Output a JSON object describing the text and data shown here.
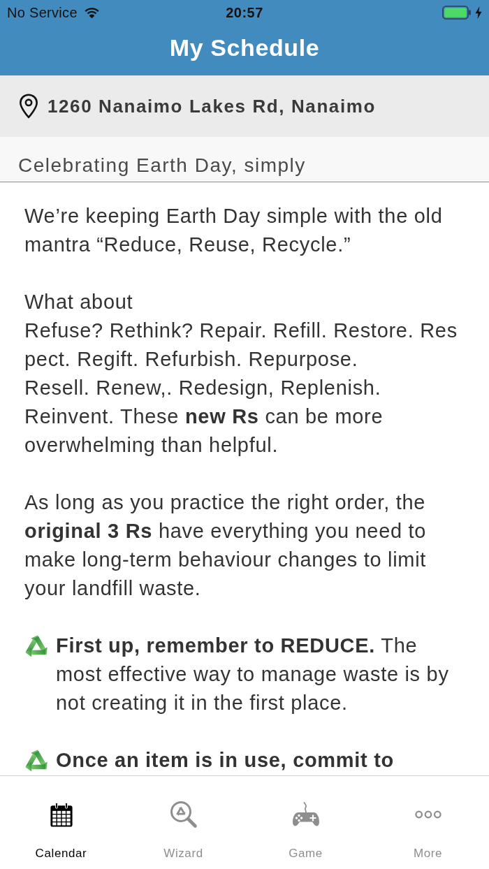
{
  "status_bar": {
    "carrier": "No Service",
    "time": "20:57"
  },
  "header": {
    "title": "My Schedule"
  },
  "location": {
    "address": "1260 Nanaimo Lakes Rd, Nanaimo"
  },
  "article": {
    "title": "Celebrating Earth Day, simply",
    "paragraphs": [
      {
        "kind": "plain",
        "bold": false,
        "text": "We’re keeping Earth Day simple with the old\nmantra “Reduce, Reuse, Recycle.”"
      },
      {
        "kind": "plain",
        "bold": false,
        "text": "What about\nRefuse? Rethink? Repair. Refill. Restore. Res\npect. Regift. Refurbish. Repurpose.\nResell. Renew,. Redesign, Replenish.\nReinvent. These **new Rs** can be more\noverwhelming than helpful."
      },
      {
        "kind": "plain",
        "bold": false,
        "text": "As long as you practice the right order, the\n**original 3 Rs** have everything you need to\nmake long-term behaviour changes to limit\nyour landfill waste."
      },
      {
        "kind": "bullet",
        "bold": false,
        "text": "**First up, remember to REDUCE.** The\nmost effective way to manage waste is by\nnot creating it in the first place."
      },
      {
        "kind": "bullet",
        "bold": true,
        "text": "Once an item is in use, commit to"
      }
    ]
  },
  "tabs": [
    {
      "label": "Calendar",
      "selected": true
    },
    {
      "label": "Wizard",
      "selected": false
    },
    {
      "label": "Game",
      "selected": false
    },
    {
      "label": "More",
      "selected": false
    }
  ]
}
